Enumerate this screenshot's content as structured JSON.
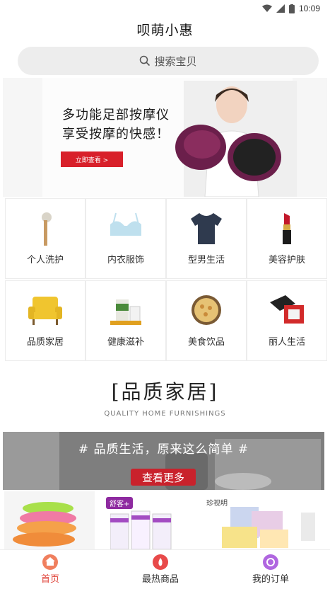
{
  "status_bar": {
    "time": "10:09",
    "icons": [
      "wifi-icon",
      "signal-icon",
      "battery-icon"
    ]
  },
  "header": {
    "title": "呗萌小惠"
  },
  "search": {
    "placeholder": "搜索宝贝",
    "icon": "search-icon"
  },
  "banner": {
    "line1": "多功能足部按摩仪",
    "line2": "享受按摩的快感！",
    "button": "立即查看 >"
  },
  "categories": [
    {
      "label": "个人洗护",
      "icon": "brush-icon"
    },
    {
      "label": "内衣服饰",
      "icon": "bra-icon"
    },
    {
      "label": "型男生活",
      "icon": "tshirt-icon"
    },
    {
      "label": "美容护肤",
      "icon": "lipstick-icon"
    },
    {
      "label": "品质家居",
      "icon": "sofa-icon"
    },
    {
      "label": "健康滋补",
      "icon": "supplement-icon"
    },
    {
      "label": "美食饮品",
      "icon": "cookie-box-icon"
    },
    {
      "label": "丽人生活",
      "icon": "gift-box-icon"
    }
  ],
  "section": {
    "title": "[品质家居]",
    "subtitle": "QUALITY HOME FURNISHINGS"
  },
  "promo": {
    "text": "# 品质生活，原来这么简单 #",
    "button": "查看更多"
  },
  "products": [
    {
      "icon": "slippers-icon"
    },
    {
      "icon": "shukeplus-toothpaste-icon",
      "brand": "舒客+"
    },
    {
      "icon": "zhenmeiming-products-icon",
      "brand": "珍视明"
    }
  ],
  "tabs": [
    {
      "label": "首页",
      "icon": "home-icon",
      "active": true
    },
    {
      "label": "最热商品",
      "icon": "fire-icon",
      "active": false
    },
    {
      "label": "我的订单",
      "icon": "order-icon",
      "active": false
    }
  ],
  "colors": {
    "accent_red": "#d8202a",
    "tab_home": "#f07f5e",
    "tab_hot": "#e84a4a",
    "tab_order": "#b066e0"
  }
}
